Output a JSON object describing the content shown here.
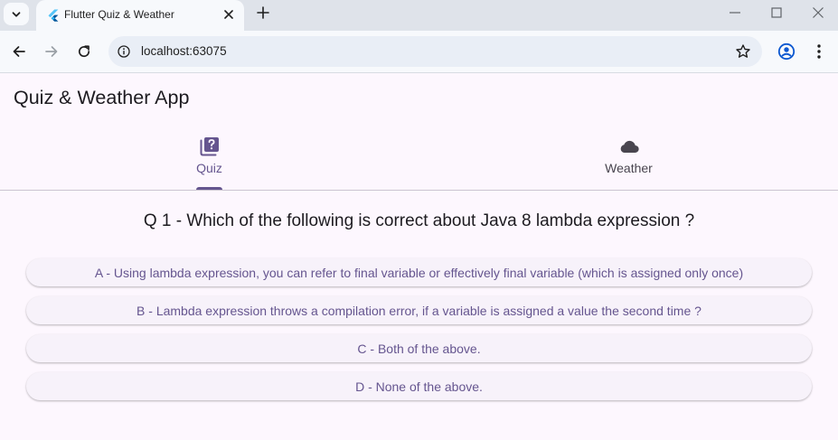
{
  "browser": {
    "tab_title": "Flutter Quiz & Weather",
    "url": "localhost:63075"
  },
  "app": {
    "title": "Quiz & Weather App",
    "tabs": [
      {
        "label": "Quiz",
        "icon": "quiz-icon",
        "selected": true
      },
      {
        "label": "Weather",
        "icon": "cloud-icon",
        "selected": false
      }
    ],
    "accent_color": "#65558f"
  },
  "quiz": {
    "question": "Q 1 - Which of the following is correct about Java 8 lambda expression ?",
    "answers": [
      "A - Using lambda expression, you can refer to final variable or effectively final variable (which is assigned only once)",
      "B - Lambda expression throws a compilation error, if a variable is assigned a value the second time ?",
      "C - Both of the above.",
      "D - None of the above."
    ]
  }
}
